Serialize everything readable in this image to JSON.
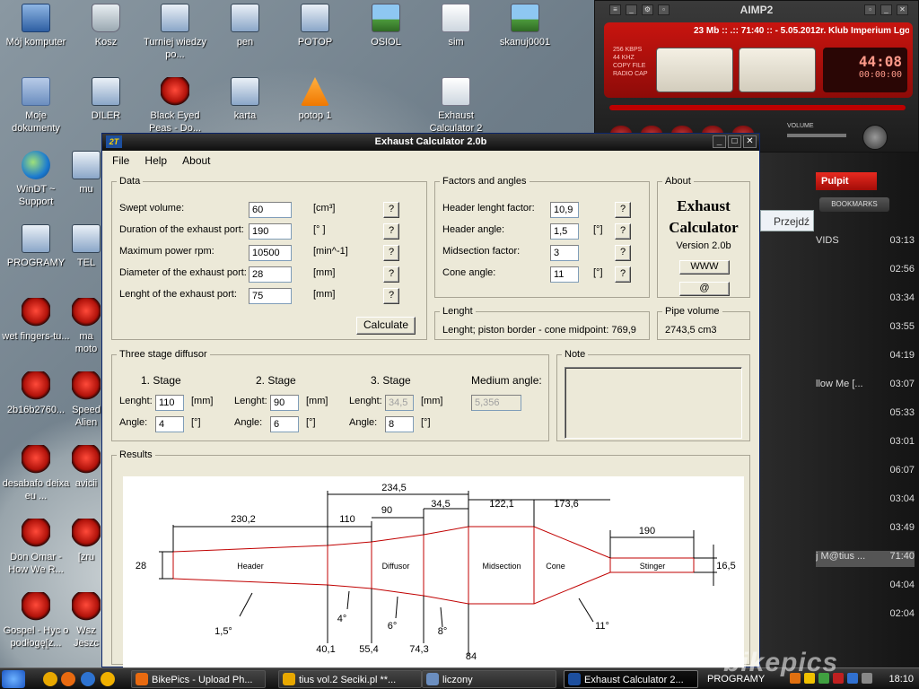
{
  "desktop": {
    "icons": [
      {
        "label": "Mój komputer"
      },
      {
        "label": "Kosz"
      },
      {
        "label": "Turniej wiedzy po..."
      },
      {
        "label": "pen"
      },
      {
        "label": "POTOP"
      },
      {
        "label": "OSIOL"
      },
      {
        "label": "sim"
      },
      {
        "label": "skanuj0001"
      },
      {
        "label": "Moje dokumenty"
      },
      {
        "label": "DILER"
      },
      {
        "label": "Black Eyed Peas - Do..."
      },
      {
        "label": "karta"
      },
      {
        "label": "potop 1"
      },
      {
        "label": "Exhaust Calculator 2"
      },
      {
        "label": "WinDT ~ Support"
      },
      {
        "label": "mu"
      },
      {
        "label": "PROGRAMY"
      },
      {
        "label": "TEL"
      },
      {
        "label": "wet fingers-tu..."
      },
      {
        "label": "ma moto"
      },
      {
        "label": "2b16b2760..."
      },
      {
        "label": "Speed Alien"
      },
      {
        "label": "desabafo deixa eu ..."
      },
      {
        "label": "avicii"
      },
      {
        "label": "Don Omar - How We R..."
      },
      {
        "label": "[zru"
      },
      {
        "label": "Gospel - Hyc o podłogę[z..."
      },
      {
        "label": "Wsz Jeszc"
      }
    ]
  },
  "aimp": {
    "title": "AIMP2",
    "scroll_text": "23 Mb :: .:: 71:40 :: - 5.05.2012r. Klub Imperium Lgota M",
    "bitrate": "256 KBPS",
    "freq": "44 KHZ",
    "copy": "COPY FILE",
    "radio": "RADIO CAP",
    "time": "44:08",
    "time2": "00:00:00",
    "volume_label": "VOLUME"
  },
  "playlist": {
    "tab": "Pulpit",
    "bookmarks": "BOOKMARKS",
    "przejdz": "Przejdź",
    "rows": [
      {
        "title": "VIDS",
        "dur": "03:13"
      },
      {
        "title": "",
        "dur": "02:56"
      },
      {
        "title": "",
        "dur": "03:34"
      },
      {
        "title": "",
        "dur": "03:55"
      },
      {
        "title": "",
        "dur": "04:19"
      },
      {
        "title": "llow Me [...",
        "dur": "03:07"
      },
      {
        "title": "",
        "dur": "05:33"
      },
      {
        "title": "",
        "dur": "03:01"
      },
      {
        "title": "",
        "dur": "06:07"
      },
      {
        "title": "",
        "dur": "03:04"
      },
      {
        "title": "",
        "dur": "03:49"
      },
      {
        "title": "j M@tius ...",
        "dur": "71:40"
      },
      {
        "title": "",
        "dur": "04:04"
      },
      {
        "title": "",
        "dur": "02:04"
      }
    ]
  },
  "dialog": {
    "logo": "2T",
    "title": "Exhaust Calculator 2.0b",
    "menu": [
      "File",
      "Help",
      "About"
    ],
    "data_group": {
      "legend": "Data",
      "rows": [
        {
          "label": "Swept volume:",
          "value": "60",
          "unit": "[cm³]",
          "q": "?"
        },
        {
          "label": "Duration of the exhaust port:",
          "value": "190",
          "unit": "[° ]",
          "q": "?"
        },
        {
          "label": "Maximum power rpm:",
          "value": "10500",
          "unit": "[min^-1]",
          "q": "?"
        },
        {
          "label": "Diameter of the exhaust port:",
          "value": "28",
          "unit": "[mm]",
          "q": "?"
        },
        {
          "label": "Lenght of the exhaust port:",
          "value": "75",
          "unit": "[mm]",
          "q": "?"
        }
      ],
      "calculate": "Calculate"
    },
    "factors_group": {
      "legend": "Factors and angles",
      "rows": [
        {
          "label": "Header lenght factor:",
          "value": "10,9",
          "unit": "",
          "q": "?"
        },
        {
          "label": "Header angle:",
          "value": "1,5",
          "unit": "[°]",
          "q": "?"
        },
        {
          "label": "Midsection factor:",
          "value": "3",
          "unit": "",
          "q": "?"
        },
        {
          "label": "Cone angle:",
          "value": "11",
          "unit": "[°]",
          "q": "?"
        }
      ]
    },
    "about_group": {
      "legend": "About",
      "line1": "Exhaust",
      "line2": "Calculator",
      "version": "Version 2.0b",
      "www": "WWW",
      "at": "@"
    },
    "lenght_group": {
      "legend": "Lenght",
      "text": "Lenght; piston border - cone midpoint:  769,9"
    },
    "volume_group": {
      "legend": "Pipe volume",
      "text": "2743,5 cm3"
    },
    "diffusor_group": {
      "legend": "Three stage diffusor",
      "stage1": "1. Stage",
      "stage2": "2. Stage",
      "stage3": "3. Stage",
      "medium": "Medium angle:",
      "lenght_label": "Lenght:",
      "angle_label": "Angle:",
      "mm": "[mm]",
      "deg": "[°]",
      "s1_len": "110",
      "s1_ang": "4",
      "s2_len": "90",
      "s2_ang": "6",
      "s3_len": "34,5",
      "s3_ang": "8",
      "medium_val": "5,356"
    },
    "note_group": {
      "legend": "Note"
    },
    "results_group": {
      "legend": "Results",
      "labels": {
        "d_header_in": "28",
        "d_stinger": "16,5",
        "header_len": "230,2",
        "s1_len": "110",
        "s2_len": "90",
        "s3_len": "34,5",
        "diffusor_total": "234,5",
        "mid_len": "122,1",
        "cone_len": "173,6",
        "stinger_len": "190",
        "header": "Header",
        "diffusor": "Diffusor",
        "midsection": "Midsection",
        "cone": "Cone",
        "stinger": "Stinger",
        "ang_header": "1,5°",
        "ang_s1": "4°",
        "ang_s2": "6°",
        "ang_s3": "8°",
        "ang_cone": "11°",
        "d1": "40,1",
        "d2": "55,4",
        "d3": "74,3",
        "d4": "84"
      }
    }
  },
  "taskbar": {
    "tasks": [
      {
        "label": "BikePics - Upload Ph..."
      },
      {
        "label": "tius vol.2 Seciki.pl **..."
      },
      {
        "label": "liczony"
      },
      {
        "label": "Exhaust Calculator 2..."
      }
    ],
    "programy": "PROGRAMY",
    "clock": "18:10"
  },
  "watermark": "bikepics"
}
